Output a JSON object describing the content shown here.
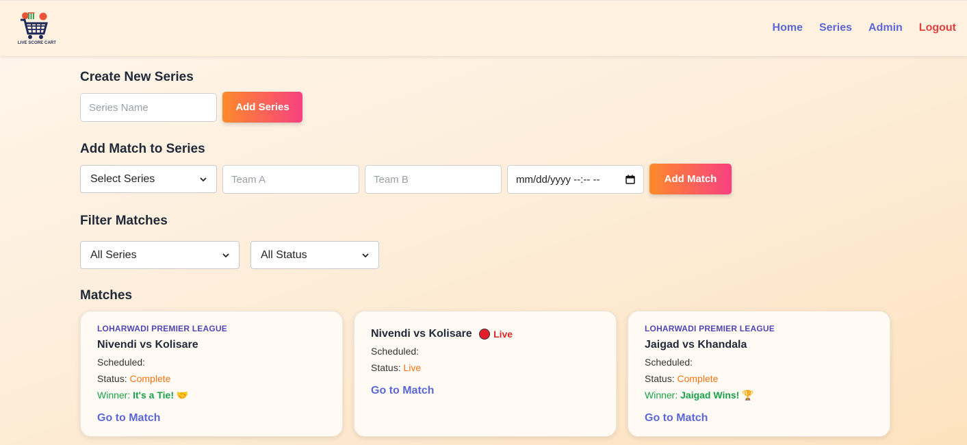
{
  "header": {
    "logo_text": "LIVE SCORE CART",
    "nav": {
      "home": "Home",
      "series": "Series",
      "admin": "Admin",
      "logout": "Logout"
    }
  },
  "create_series": {
    "heading": "Create New Series",
    "name_placeholder": "Series Name",
    "add_button": "Add Series"
  },
  "add_match": {
    "heading": "Add Match to Series",
    "series_select": "Select Series",
    "team_a_placeholder": "Team A",
    "team_b_placeholder": "Team B",
    "datetime_placeholder": "mm/dd/yyyy --:-- --",
    "add_button": "Add Match"
  },
  "filter": {
    "heading": "Filter Matches",
    "series_select": "All Series",
    "status_select": "All Status"
  },
  "matches": {
    "heading": "Matches",
    "cards": [
      {
        "series": "LOHARWADI PREMIER LEAGUE",
        "title": "Nivendi vs Kolisare",
        "scheduled_label": "Scheduled:",
        "status_label": "Status:",
        "status": "Complete",
        "winner_label": "Winner:",
        "winner": "It's a Tie! 🤝",
        "link": "Go to Match"
      },
      {
        "title": "Nivendi vs Kolisare",
        "live_label": "Live",
        "scheduled_label": "Scheduled:",
        "status_label": "Status:",
        "status": "Live",
        "link": "Go to Match"
      },
      {
        "series": "LOHARWADI PREMIER LEAGUE",
        "title": "Jaigad vs Khandala",
        "scheduled_label": "Scheduled:",
        "status_label": "Status:",
        "status": "Complete",
        "winner_label": "Winner:",
        "winner": "Jaigad Wins! 🏆",
        "link": "Go to Match"
      }
    ]
  }
}
